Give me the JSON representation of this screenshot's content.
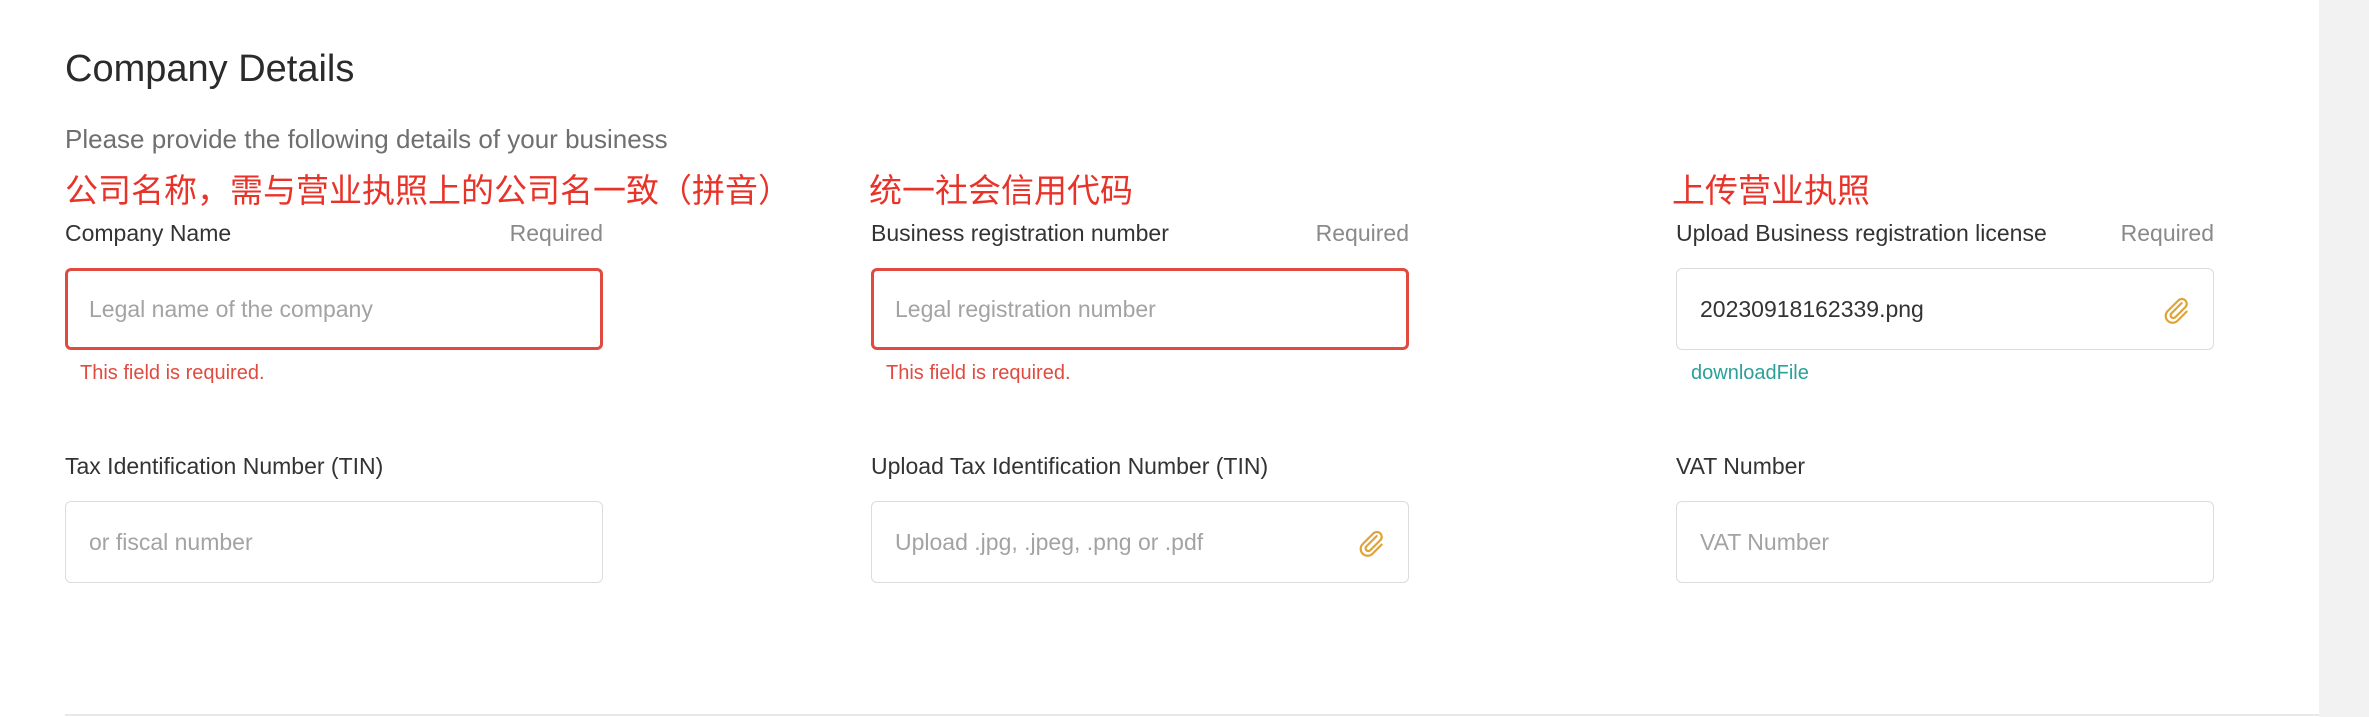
{
  "header": {
    "title": "Company Details",
    "subtitle": "Please provide the following details of your business"
  },
  "annotations": {
    "company_name": "公司名称，需与营业执照上的公司名一致（拼音）",
    "registration_number": "统一社会信用代码",
    "registration_license": "上传营业执照"
  },
  "fields": {
    "company_name": {
      "label": "Company Name",
      "required": "Required",
      "placeholder": "Legal name of the company",
      "error": "This field is required."
    },
    "registration_number": {
      "label": "Business registration number",
      "required": "Required",
      "placeholder": "Legal registration number",
      "error": "This field is required."
    },
    "registration_license": {
      "label": "Upload Business registration license",
      "required": "Required",
      "value": "20230918162339.png",
      "link": "downloadFile",
      "icon": "paperclip-icon"
    },
    "tin": {
      "label": "Tax Identification Number (TIN)",
      "placeholder": "or fiscal number"
    },
    "tin_upload": {
      "label": "Upload Tax Identification Number (TIN)",
      "placeholder": "Upload .jpg, .jpeg, .png or .pdf",
      "icon": "paperclip-icon"
    },
    "vat": {
      "label": "VAT Number",
      "placeholder": "VAT Number"
    }
  },
  "colors": {
    "error": "#e04a3f",
    "annotation": "#e8332a",
    "link": "#2aa198",
    "icon": "#e0a33a"
  }
}
